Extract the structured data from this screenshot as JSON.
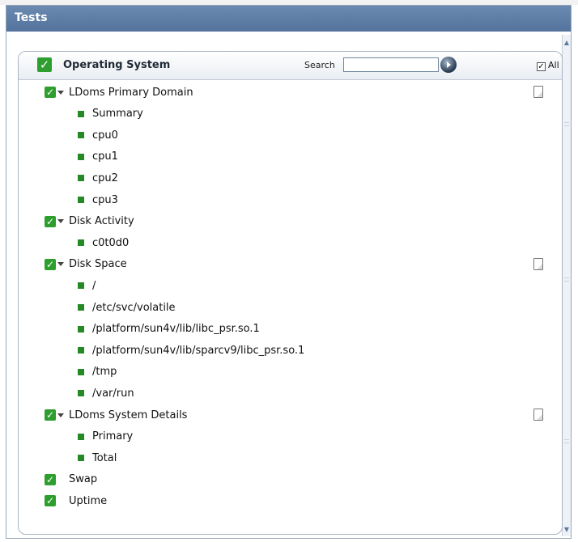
{
  "window": {
    "title": "Tests"
  },
  "panel": {
    "title": "Operating System",
    "search_label": "Search",
    "search_value": "",
    "all_label": "All",
    "all_checked": true
  },
  "tree": [
    {
      "kind": "parent",
      "label": "LDoms Primary Domain",
      "has_doc": true
    },
    {
      "kind": "child",
      "label": "Summary"
    },
    {
      "kind": "child",
      "label": "cpu0"
    },
    {
      "kind": "child",
      "label": "cpu1"
    },
    {
      "kind": "child",
      "label": "cpu2"
    },
    {
      "kind": "child",
      "label": "cpu3"
    },
    {
      "kind": "parent",
      "label": "Disk Activity",
      "has_doc": false
    },
    {
      "kind": "child",
      "label": "c0t0d0"
    },
    {
      "kind": "parent",
      "label": "Disk Space",
      "has_doc": true
    },
    {
      "kind": "child",
      "label": "/"
    },
    {
      "kind": "child",
      "label": "/etc/svc/volatile"
    },
    {
      "kind": "child",
      "label": "/platform/sun4v/lib/libc_psr.so.1"
    },
    {
      "kind": "child",
      "label": "/platform/sun4v/lib/sparcv9/libc_psr.so.1"
    },
    {
      "kind": "child",
      "label": "/tmp"
    },
    {
      "kind": "child",
      "label": "/var/run"
    },
    {
      "kind": "parent",
      "label": "LDoms System Details",
      "has_doc": true
    },
    {
      "kind": "child",
      "label": "Primary"
    },
    {
      "kind": "child",
      "label": "Total"
    },
    {
      "kind": "leaf",
      "label": "Swap"
    },
    {
      "kind": "leaf",
      "label": "Uptime"
    }
  ],
  "colors": {
    "check_green": "#2e9e2f",
    "title_bar": "#5f7fa8"
  }
}
